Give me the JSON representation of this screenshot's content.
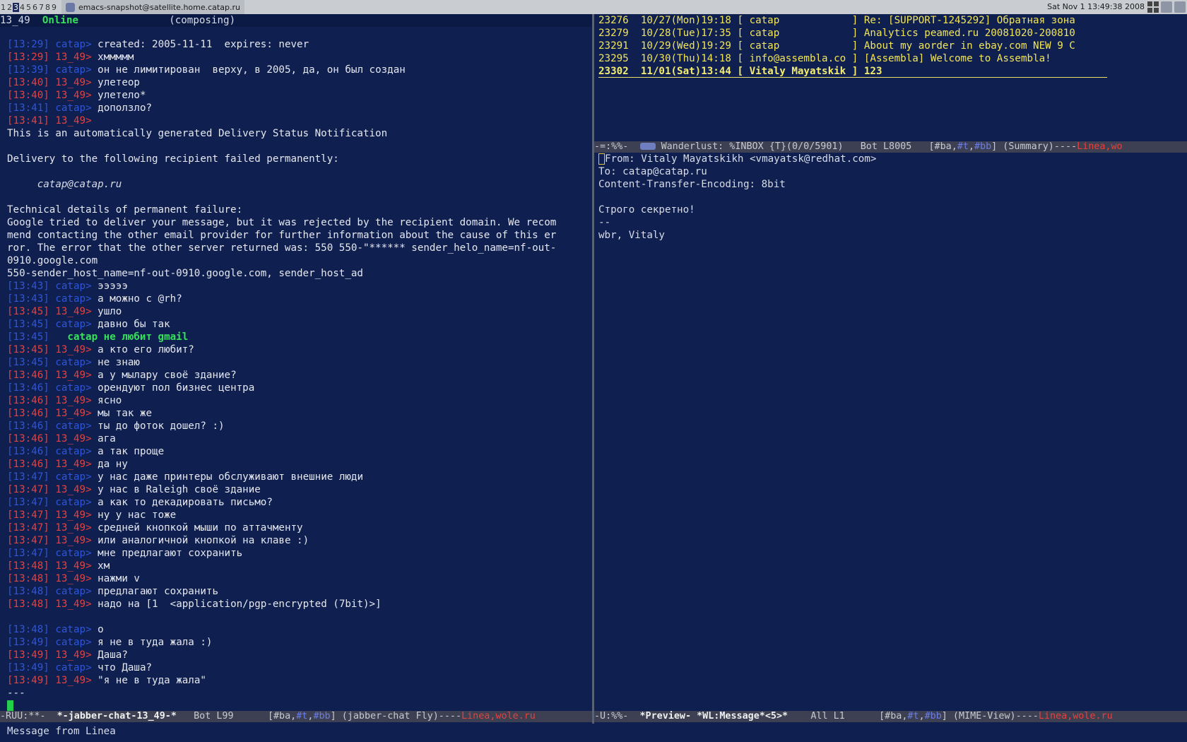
{
  "topbar": {
    "workspaces": [
      "1",
      "2",
      "3",
      "4",
      "5",
      "6",
      "7",
      "8",
      "9"
    ],
    "active_workspace": "3",
    "task_title": "emacs-snapshot@satellite.home.catap.ru",
    "clock": "Sat Nov  1 13:49:38 2008"
  },
  "chat": {
    "header_nick": "13_49",
    "header_status": "Online",
    "header_state": "(composing)",
    "lines": [
      {
        "k": "b",
        "t": "[13:29]",
        "n": "catap",
        "m": "created: 2005-11-11  expires: never"
      },
      {
        "k": "r",
        "t": "[13:29]",
        "n": "13_49",
        "m": "хммммм"
      },
      {
        "k": "b",
        "t": "[13:39]",
        "n": "catap",
        "m": "он не лимитирован  верху, в 2005, да, он был создан"
      },
      {
        "k": "r",
        "t": "[13:40]",
        "n": "13_49",
        "m": "улетеор"
      },
      {
        "k": "r",
        "t": "[13:40]",
        "n": "13_49",
        "m": "улетело*"
      },
      {
        "k": "b",
        "t": "[13:41]",
        "n": "catap",
        "m": "доползло?"
      },
      {
        "k": "r",
        "t": "[13:41]",
        "n": "13_49",
        "m": ""
      },
      {
        "k": "p",
        "m": "This is an automatically generated Delivery Status Notification"
      },
      {
        "k": "p",
        "m": ""
      },
      {
        "k": "p",
        "m": "Delivery to the following recipient failed permanently:"
      },
      {
        "k": "p",
        "m": ""
      },
      {
        "k": "i",
        "m": "     catap@catap.ru"
      },
      {
        "k": "p",
        "m": ""
      },
      {
        "k": "p",
        "m": "Technical details of permanent failure:"
      },
      {
        "k": "w",
        "m": "Google tried to deliver your message, but it was rejected by the recipient domain. We recom"
      },
      {
        "k": "w",
        "m": "mend contacting the other email provider for further information about the cause of this er"
      },
      {
        "k": "w",
        "m": "ror. The error that the other server returned was: 550 550-\"****** sender_helo_name=nf-out-"
      },
      {
        "k": "w",
        "m": "0910.google.com"
      },
      {
        "k": "p",
        "m": "550-sender_host_name=nf-out-0910.google.com, sender_host_ad"
      },
      {
        "k": "b",
        "t": "[13:43]",
        "n": "catap",
        "m": "эээээ"
      },
      {
        "k": "b",
        "t": "[13:43]",
        "n": "catap",
        "m": "а можно с @rh?"
      },
      {
        "k": "r",
        "t": "[13:45]",
        "n": "13_49",
        "m": "ушло"
      },
      {
        "k": "b",
        "t": "[13:45]",
        "n": "catap",
        "m": "давно бы так"
      },
      {
        "k": "g",
        "t": "[13:45]",
        "m": "catap не любит gmail"
      },
      {
        "k": "r",
        "t": "[13:45]",
        "n": "13_49",
        "m": "а кто его любит?"
      },
      {
        "k": "b",
        "t": "[13:45]",
        "n": "catap",
        "m": "не знаю"
      },
      {
        "k": "r",
        "t": "[13:46]",
        "n": "13_49",
        "m": "а у мылару своё здание?"
      },
      {
        "k": "b",
        "t": "[13:46]",
        "n": "catap",
        "m": "орендуют пол бизнес центра"
      },
      {
        "k": "r",
        "t": "[13:46]",
        "n": "13_49",
        "m": "ясно"
      },
      {
        "k": "r",
        "t": "[13:46]",
        "n": "13_49",
        "m": "мы так же"
      },
      {
        "k": "b",
        "t": "[13:46]",
        "n": "catap",
        "m": "ты до фоток дошел? :)"
      },
      {
        "k": "r",
        "t": "[13:46]",
        "n": "13_49",
        "m": "ага"
      },
      {
        "k": "b",
        "t": "[13:46]",
        "n": "catap",
        "m": "а так проще"
      },
      {
        "k": "r",
        "t": "[13:46]",
        "n": "13_49",
        "m": "да ну"
      },
      {
        "k": "b",
        "t": "[13:47]",
        "n": "catap",
        "m": "у нас даже принтеры обслуживают внешние люди"
      },
      {
        "k": "r",
        "t": "[13:47]",
        "n": "13_49",
        "m": "у нас в Raleigh своё здание"
      },
      {
        "k": "b",
        "t": "[13:47]",
        "n": "catap",
        "m": "а как то декадировать письмо?"
      },
      {
        "k": "r",
        "t": "[13:47]",
        "n": "13_49",
        "m": "ну у нас тоже"
      },
      {
        "k": "r",
        "t": "[13:47]",
        "n": "13_49",
        "m": "средней кнопкой мыши по аттачменту"
      },
      {
        "k": "r",
        "t": "[13:47]",
        "n": "13_49",
        "m": "или аналогичной кнопкой на клаве :)"
      },
      {
        "k": "b",
        "t": "[13:47]",
        "n": "catap",
        "m": "мне предлагают сохранить"
      },
      {
        "k": "r",
        "t": "[13:48]",
        "n": "13_49",
        "m": "хм"
      },
      {
        "k": "r",
        "t": "[13:48]",
        "n": "13_49",
        "m": "нажми v"
      },
      {
        "k": "b",
        "t": "[13:48]",
        "n": "catap",
        "m": "предлагают сохранить"
      },
      {
        "k": "r",
        "t": "[13:48]",
        "n": "13_49",
        "m": "надо на [1  <application/pgp-encrypted (7bit)>]"
      },
      {
        "k": "p",
        "m": ""
      },
      {
        "k": "b",
        "t": "[13:48]",
        "n": "catap",
        "m": "о"
      },
      {
        "k": "b",
        "t": "[13:49]",
        "n": "catap",
        "m": "я не в туда жала :)"
      },
      {
        "k": "r",
        "t": "[13:49]",
        "n": "13_49",
        "m": "Даша?"
      },
      {
        "k": "b",
        "t": "[13:49]",
        "n": "catap",
        "m": "что Даша?"
      },
      {
        "k": "r",
        "t": "[13:49]",
        "n": "13_49",
        "m": "\"я не в туда жала\""
      },
      {
        "k": "p",
        "m": "---"
      }
    ]
  },
  "summary": {
    "rows": [
      {
        "num": "23276",
        "date": "10/27(Mon)19:18",
        "from": "catap",
        "subject": "Re: [SUPPORT-1245292] Обратная зона"
      },
      {
        "num": "23279",
        "date": "10/28(Tue)17:35",
        "from": "catap",
        "subject": "Analytics peamed.ru 20081020-200810"
      },
      {
        "num": "23291",
        "date": "10/29(Wed)19:29",
        "from": "catap",
        "subject": "About my aorder in ebay.com NEW 9 C"
      },
      {
        "num": "23295",
        "date": "10/30(Thu)14:18",
        "from": "info@assembla.co",
        "subject": "[Assembla] Welcome to Assembla!"
      },
      {
        "num": "23302",
        "date": "11/01(Sat)13:44",
        "from": "Vitaly Mayatskik",
        "subject": "123"
      }
    ]
  },
  "summary_modeline": {
    "prefix": "-=:%%-  ",
    "buffer": "Wanderlust: %INBOX {T}(0/0/5901)",
    "pos": "Bot L8005",
    "tags_a": "[#ba,",
    "tag_t": "#t",
    "tag_sep": ",",
    "tag_bb": "#bb",
    "tags_end": "]",
    "mode": "(Summary)----",
    "tail": "Linea,wo"
  },
  "message": {
    "from_label": "From:",
    "from_value": "Vitaly Mayatskikh <vmayatsk@redhat.com>",
    "to": "To: catap@catap.ru",
    "cte": "Content-Transfer-Encoding: 8bit",
    "blank": "",
    "body": [
      "Строго секретно!",
      "--",
      "wbr, Vitaly"
    ]
  },
  "chat_modeline": {
    "prefix": "-RUU:**-  ",
    "buffer": "*-jabber-chat-13_49-*",
    "pos": "Bot L99",
    "tags_a": "[#ba,",
    "tag_t": "#t",
    "tag_sep": ",",
    "tag_bb": "#bb",
    "tags_end": "]",
    "mode": "(jabber-chat Fly)----",
    "tail": "Linea,wole.ru"
  },
  "msg_modeline": {
    "prefix": "-U:%%-  ",
    "buffer": "*Preview- *WL:Message*<5>*",
    "pos": "All L1",
    "tags_a": "[#ba,",
    "tag_t": "#t",
    "tag_sep": ",",
    "tag_bb": "#bb",
    "tags_end": "]",
    "mode": "(MIME-View)----",
    "tail": "Linea,wole.ru"
  },
  "minibuffer": {
    "text": "Message from Linea"
  },
  "colors": {
    "background": "#0f1f4f",
    "self_red": "#e8413c",
    "peer_blue": "#2f56d8",
    "status_green": "#35e25a",
    "summary_yellow": "#f2e55a",
    "modeline": "#3c4052"
  }
}
